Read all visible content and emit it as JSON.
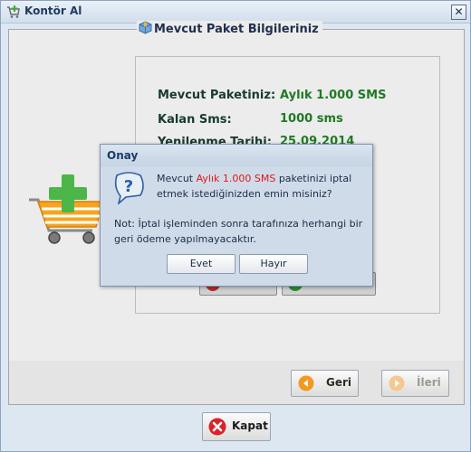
{
  "window": {
    "title": "Kontör Al",
    "close_glyph": "✕"
  },
  "package_info": {
    "title": "Mevcut Paket Bilgileriniz",
    "rows": [
      {
        "label": "Mevcut Paketiniz:",
        "value": "Aylık 1.000 SMS"
      },
      {
        "label": "Kalan Sms:",
        "value": "1000 sms"
      },
      {
        "label": "Yenilenme Tarihi:",
        "value": "25.09.2014"
      }
    ]
  },
  "navigation": {
    "back_label": "Geri",
    "next_label": "İleri"
  },
  "footer": {
    "close_label": "Kapat"
  },
  "dialog": {
    "title": "Onay",
    "message_prefix": "Mevcut ",
    "message_package": "Aylık 1.000 SMS",
    "message_suffix": " paketinizi iptal etmek istediğinizden emin misiniz?",
    "note": "Not: İptal işleminden sonra tarafınıza herhangi bir geri ödeme yapılmayacaktır.",
    "yes_label": "Evet",
    "no_label": "Hayır"
  },
  "colors": {
    "package_value": "#1f7a24",
    "highlight": "#e01919",
    "back_icon": "#f39a1e",
    "close_icon": "#d9232b"
  },
  "icons": [
    "shopping-cart-add-icon",
    "package-icon",
    "question-icon",
    "arrow-left-icon",
    "arrow-right-icon",
    "close-x-icon"
  ]
}
